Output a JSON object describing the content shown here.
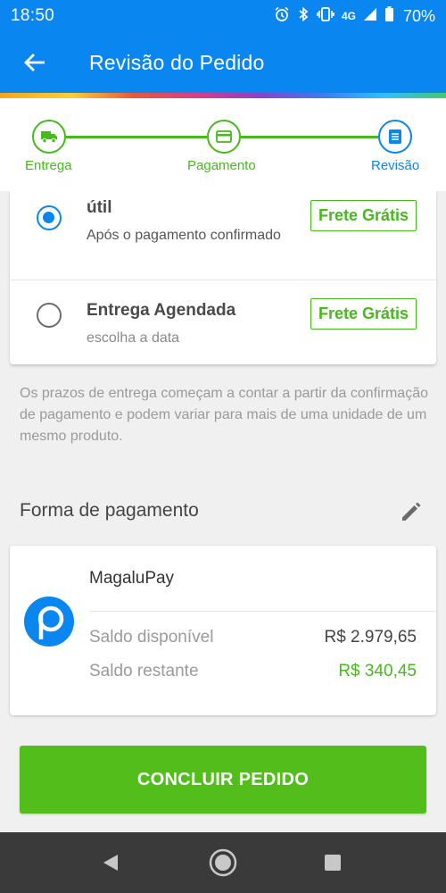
{
  "status_bar": {
    "time": "18:50",
    "network": "4G",
    "battery": "70%",
    "icons": [
      "alarm-icon",
      "bluetooth-icon",
      "vibrate-icon",
      "signal-icon",
      "battery-icon"
    ]
  },
  "app_bar": {
    "title": "Revisão do Pedido",
    "back_icon": "arrow-left-icon"
  },
  "stepper": {
    "steps": [
      {
        "label": "Entrega",
        "icon": "truck-icon",
        "state": "done"
      },
      {
        "label": "Pagamento",
        "icon": "card-icon",
        "state": "done"
      },
      {
        "label": "Revisão",
        "icon": "list-icon",
        "state": "current"
      }
    ]
  },
  "delivery": {
    "options": [
      {
        "title": "útil",
        "subtitle": "Após o pagamento confirmado",
        "badge": "Frete Grátis",
        "selected": true
      },
      {
        "title": "Entrega Agendada",
        "subtitle": "escolha a data",
        "badge": "Frete Grátis",
        "selected": false
      }
    ],
    "note": "Os prazos de entrega começam a contar a partir da confirmação de pagamento e podem variar para mais de uma unidade de um mesmo produto."
  },
  "payment": {
    "section_title": "Forma de pagamento",
    "edit_icon": "pencil-icon",
    "method_name": "MagaluPay",
    "logo_icon": "magalupay-logo-icon",
    "rows": [
      {
        "label": "Saldo disponível",
        "value": "R$ 2.979,65"
      },
      {
        "label": "Saldo restante",
        "value": "R$ 340,45"
      }
    ]
  },
  "cta": {
    "label": "CONCLUIR PEDIDO"
  },
  "colors": {
    "primary_blue": "#0a86f0",
    "green": "#47b91d",
    "button_green": "#52be1c",
    "nav_bar": "#3a3a3a"
  }
}
